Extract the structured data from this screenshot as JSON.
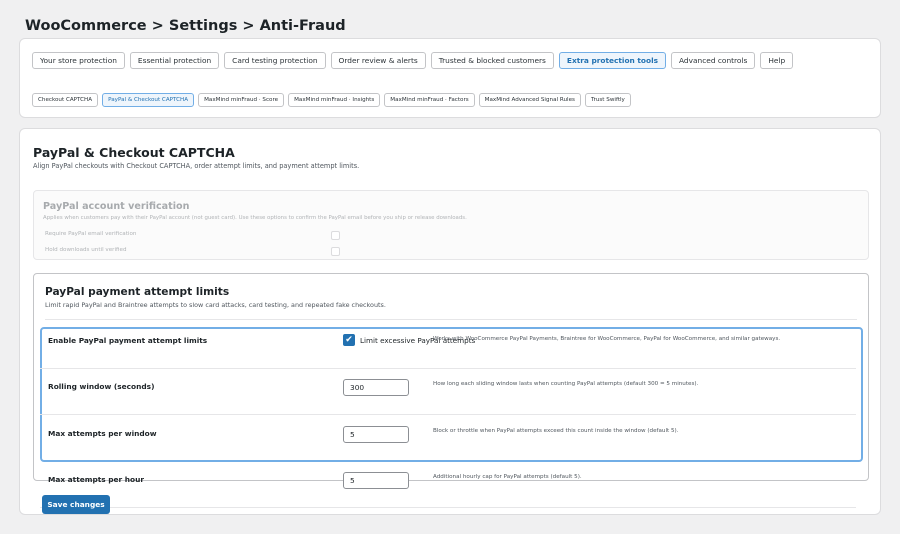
{
  "page": {
    "title": "WooCommerce > Settings > Anti-Fraud"
  },
  "tabs": [
    {
      "label": "Your store protection",
      "active": false
    },
    {
      "label": "Essential protection",
      "active": false
    },
    {
      "label": "Card testing protection",
      "active": false
    },
    {
      "label": "Order review & alerts",
      "active": false
    },
    {
      "label": "Trusted & blocked customers",
      "active": false
    },
    {
      "label": "Extra protection tools",
      "active": true
    },
    {
      "label": "Advanced controls",
      "active": false
    },
    {
      "label": "Help",
      "active": false
    }
  ],
  "subtabs": [
    {
      "label": "Checkout CAPTCHA",
      "active": false
    },
    {
      "label": "PayPal & Checkout CAPTCHA",
      "active": true
    },
    {
      "label": "MaxMind minFraud · Score",
      "active": false
    },
    {
      "label": "MaxMind minFraud · Insights",
      "active": false
    },
    {
      "label": "MaxMind minFraud · Factors",
      "active": false
    },
    {
      "label": "MaxMind Advanced Signal Rules",
      "active": false
    },
    {
      "label": "Trust Swiftly",
      "active": false
    }
  ],
  "section": {
    "title": "PayPal & Checkout CAPTCHA",
    "description": "Align PayPal checkouts with Checkout CAPTCHA, order attempt limits, and payment attempt limits."
  },
  "verification": {
    "title": "PayPal account verification",
    "description": "Applies when customers pay with their PayPal account (not guest card). Use these options to confirm the PayPal email before you ship or release downloads.",
    "require_label": "Require PayPal email verification",
    "hold_label": "Hold downloads until verified"
  },
  "limits": {
    "title": "PayPal payment attempt limits",
    "description": "Limit rapid PayPal and Braintree attempts to slow card attacks, card testing, and repeated fake checkouts.",
    "enable": {
      "label": "Enable PayPal payment attempt limits",
      "checkbox_label": "Limit excessive PayPal attempts",
      "checked": true,
      "help": "Works with WooCommerce PayPal Payments, Braintree for WooCommerce, PayPal for WooCommerce, and similar gateways."
    },
    "rolling_window": {
      "label": "Rolling window (seconds)",
      "value": "300",
      "help": "How long each sliding window lasts when counting PayPal attempts (default 300 = 5 minutes)."
    },
    "max_per_window": {
      "label": "Max attempts per window",
      "value": "5",
      "help": "Block or throttle when PayPal attempts exceed this count inside the window (default 5)."
    },
    "max_per_hour": {
      "label": "Max attempts per hour",
      "value": "5",
      "help": "Additional hourly cap for PayPal attempts (default 5)."
    }
  },
  "actions": {
    "save_label": "Save changes"
  },
  "colors": {
    "accent": "#2271b1",
    "highlight_border": "#72aee6",
    "background": "#f0f0f1"
  }
}
